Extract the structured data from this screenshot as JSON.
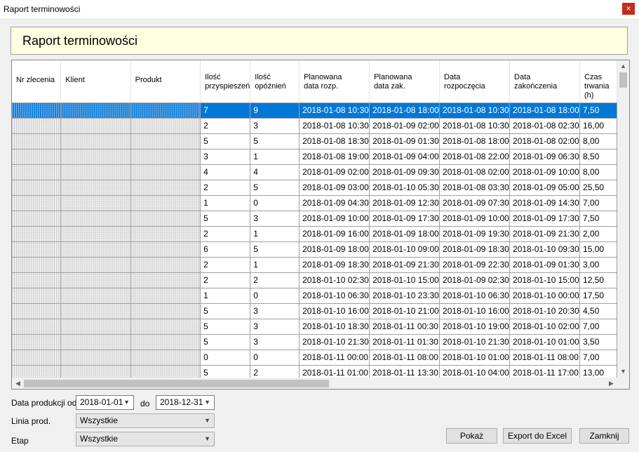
{
  "window": {
    "title": "Raport terminowości",
    "close_icon": "×"
  },
  "header": {
    "title": "Raport terminowości"
  },
  "grid": {
    "columns": [
      "Nr zlecenia",
      "Klient",
      "Produkt",
      "Ilość przyspieszeń",
      "Ilość opóźnień",
      "Planowana data rozp.",
      "Planowana data zak.",
      "Data rozpoczęcia",
      "Data zakończenia",
      "Czas trwania (h)"
    ],
    "column_labels": [
      [
        "Nr zlecenia"
      ],
      [
        "Klient"
      ],
      [
        "Produkt"
      ],
      [
        "Ilość",
        "przyspieszeń"
      ],
      [
        "Ilość",
        "opóźnień"
      ],
      [
        "Planowana",
        "data rozp."
      ],
      [
        "Planowana",
        "data zak."
      ],
      [
        "Data",
        "rozpoczęcia"
      ],
      [
        "Data",
        "zakończenia"
      ],
      [
        "Czas",
        "trwania",
        "(h)"
      ]
    ],
    "selected_row": 0,
    "rows": [
      [
        "7",
        "9",
        "2018-01-08 10:30",
        "2018-01-08 18:00",
        "2018-01-08 10:30",
        "2018-01-08 18:00",
        "7,50"
      ],
      [
        "2",
        "3",
        "2018-01-08 10:30",
        "2018-01-09 02:00",
        "2018-01-08 10:30",
        "2018-01-08 02:30",
        "16,00"
      ],
      [
        "5",
        "5",
        "2018-01-08 18:30",
        "2018-01-09 01:30",
        "2018-01-08 18:00",
        "2018-01-08 02:00",
        "8,00"
      ],
      [
        "3",
        "1",
        "2018-01-08 19:00",
        "2018-01-09 04:00",
        "2018-01-08 22:00",
        "2018-01-09 06:30",
        "8,50"
      ],
      [
        "4",
        "4",
        "2018-01-09 02:00",
        "2018-01-09 09:30",
        "2018-01-08 02:00",
        "2018-01-09 10:00",
        "8,00"
      ],
      [
        "2",
        "5",
        "2018-01-09 03:00",
        "2018-01-10 05:30",
        "2018-01-08 03:30",
        "2018-01-09 05:00",
        "25,50"
      ],
      [
        "1",
        "0",
        "2018-01-09 04:30",
        "2018-01-09 12:30",
        "2018-01-09 07:30",
        "2018-01-09 14:30",
        "7,00"
      ],
      [
        "5",
        "3",
        "2018-01-09 10:00",
        "2018-01-09 17:30",
        "2018-01-09 10:00",
        "2018-01-09 17:30",
        "7,50"
      ],
      [
        "2",
        "1",
        "2018-01-09 16:00",
        "2018-01-09 18:00",
        "2018-01-09 19:30",
        "2018-01-09 21:30",
        "2,00"
      ],
      [
        "6",
        "5",
        "2018-01-09 18:00",
        "2018-01-10 09:00",
        "2018-01-09 18:30",
        "2018-01-10 09:30",
        "15,00"
      ],
      [
        "2",
        "1",
        "2018-01-09 18:30",
        "2018-01-09 21:30",
        "2018-01-09 22:30",
        "2018-01-09 01:30",
        "3,00"
      ],
      [
        "2",
        "2",
        "2018-01-10 02:30",
        "2018-01-10 15:00",
        "2018-01-09 02:30",
        "2018-01-10 15:00",
        "12,50"
      ],
      [
        "1",
        "0",
        "2018-01-10 06:30",
        "2018-01-10 23:30",
        "2018-01-10 06:30",
        "2018-01-10 00:00",
        "17,50"
      ],
      [
        "5",
        "3",
        "2018-01-10 16:00",
        "2018-01-10 21:00",
        "2018-01-10 16:00",
        "2018-01-10 20:30",
        "4,50"
      ],
      [
        "5",
        "3",
        "2018-01-10 18:30",
        "2018-01-11 00:30",
        "2018-01-10 19:00",
        "2018-01-10 02:00",
        "7,00"
      ],
      [
        "5",
        "3",
        "2018-01-10 21:30",
        "2018-01-11 01:30",
        "2018-01-10 21:30",
        "2018-01-10 01:00",
        "3,50"
      ],
      [
        "0",
        "0",
        "2018-01-11 00:00",
        "2018-01-11 08:00",
        "2018-01-10 01:00",
        "2018-01-11 08:00",
        "7,00"
      ],
      [
        "5",
        "2",
        "2018-01-11 01:00",
        "2018-01-11 13:30",
        "2018-01-10 04:00",
        "2018-01-11 17:00",
        "13,00"
      ]
    ]
  },
  "filters": {
    "date_label": "Data produkcji od",
    "date_from": "2018-01-01",
    "to_label": "do",
    "date_to": "2018-12-31",
    "line_label": "Linia prod.",
    "line_value": "Wszystkie",
    "stage_label": "Etap",
    "stage_value": "Wszystkie"
  },
  "buttons": {
    "show": "Pokaż",
    "export": "Export do Excel",
    "close": "Zamknij"
  },
  "icons": {
    "dropdown": "chevron-down-icon",
    "scroll_up": "▲",
    "scroll_down": "▼",
    "scroll_left": "◀",
    "scroll_right": "▶"
  }
}
